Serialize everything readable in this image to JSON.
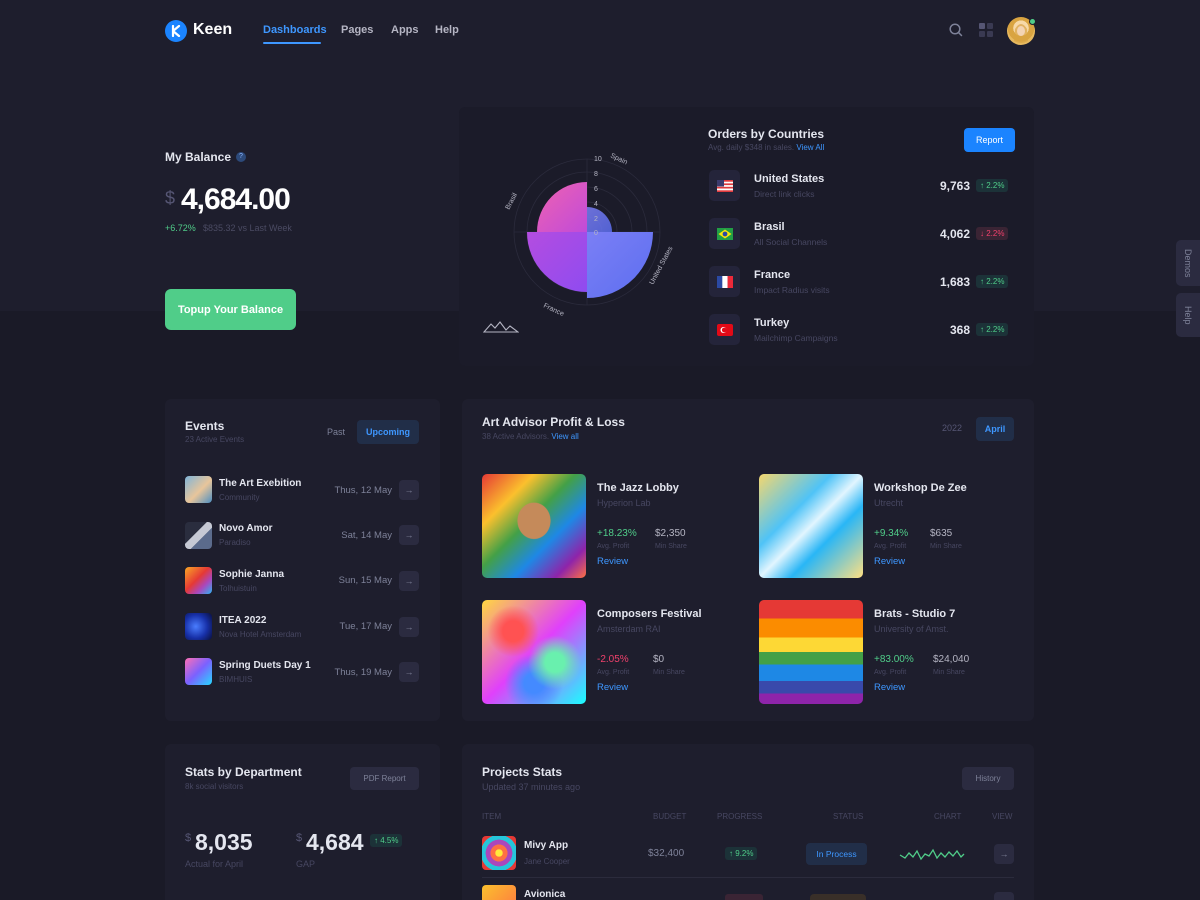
{
  "header": {
    "logo_text": "Keen",
    "nav": [
      "Dashboards",
      "Pages",
      "Apps",
      "Help"
    ]
  },
  "balance": {
    "title": "My Balance",
    "currency": "$",
    "amount": "4,684.00",
    "change": "+6.72%",
    "sub": "$835.32 vs Last Week",
    "topup_label": "Topup Your Balance"
  },
  "orders": {
    "title": "Orders by Countries",
    "sub_prefix": "Avg. daily $348 in sales.",
    "view_all": "View All",
    "report_label": "Report",
    "countries": [
      {
        "name": "United States",
        "sub": "Direct link clicks",
        "value": "9,763",
        "change": "2.2%",
        "dir": "up"
      },
      {
        "name": "Brasil",
        "sub": "All Social Channels",
        "value": "4,062",
        "change": "2.2%",
        "dir": "down"
      },
      {
        "name": "France",
        "sub": "Impact Radius visits",
        "value": "1,683",
        "change": "2.2%",
        "dir": "up"
      },
      {
        "name": "Turkey",
        "sub": "Mailchimp Campaigns",
        "value": "368",
        "change": "2.2%",
        "dir": "up"
      }
    ],
    "polar": {
      "labels": [
        "Spain",
        "United States",
        "France",
        "Brasil"
      ],
      "ticks": [
        "10",
        "8",
        "6",
        "4",
        "2",
        "0"
      ]
    }
  },
  "side_tabs": [
    "Demos",
    "Help"
  ],
  "events": {
    "title": "Events",
    "sub": "23 Active Events",
    "past_label": "Past",
    "upcoming_label": "Upcoming",
    "items": [
      {
        "title": "The Art Exebition",
        "sub": "Community",
        "date": "Thus, 12 May"
      },
      {
        "title": "Novo Amor",
        "sub": "Paradiso",
        "date": "Sat, 14 May"
      },
      {
        "title": "Sophie Janna",
        "sub": "Tolhuistuin",
        "date": "Sun, 15 May"
      },
      {
        "title": "ITEA 2022",
        "sub": "Nova Hotel Amsterdam",
        "date": "Tue, 17 May"
      },
      {
        "title": "Spring Duets Day 1",
        "sub": "BIMHUIS",
        "date": "Thus, 19 May"
      }
    ]
  },
  "art": {
    "title": "Art Advisor Profit & Loss",
    "sub_prefix": "38 Active Advisors.",
    "view_all": "View all",
    "year": "2022",
    "month_label": "April",
    "profit_label": "Avg. Profit",
    "share_label": "Min Share",
    "review_label": "Review",
    "items": [
      {
        "title": "The Jazz Lobby",
        "sub": "Hyperion Lab",
        "pct": "+18.23%",
        "money": "$2,350",
        "dir": "up"
      },
      {
        "title": "Workshop De Zee",
        "sub": "Utrecht",
        "pct": "+9.34%",
        "money": "$635",
        "dir": "up"
      },
      {
        "title": "Composers Festival",
        "sub": "Amsterdam RAI",
        "pct": "-2.05%",
        "money": "$0",
        "dir": "down"
      },
      {
        "title": "Brats - Studio 7",
        "sub": "University of Amst.",
        "pct": "+83.00%",
        "money": "$24,040",
        "dir": "up"
      }
    ]
  },
  "dept": {
    "title": "Stats by Department",
    "sub": "8k social visitors",
    "pdf_label": "PDF Report",
    "actual_currency": "$",
    "actual_value": "8,035",
    "actual_label": "Actual for April",
    "gap_currency": "$",
    "gap_value": "4,684",
    "gap_badge": "4.5%",
    "gap_label": "GAP"
  },
  "projects": {
    "title": "Projects Stats",
    "sub": "Updated 37 minutes ago",
    "history_label": "History",
    "columns": [
      "ITEM",
      "BUDGET",
      "PROGRESS",
      "STATUS",
      "CHART",
      "VIEW"
    ],
    "rows": [
      {
        "name": "Mivy App",
        "owner": "Jane Cooper",
        "budget": "$32,400",
        "progress": "9.2%",
        "status": "In Process"
      },
      {
        "name": "Avionica",
        "owner": "",
        "budget": "",
        "progress": "",
        "status": ""
      }
    ]
  },
  "colors": {
    "bg": "#1a1a27",
    "card": "#1e1e2d",
    "primary": "#1b84ff",
    "success": "#50cd89",
    "danger": "#f1416c"
  }
}
